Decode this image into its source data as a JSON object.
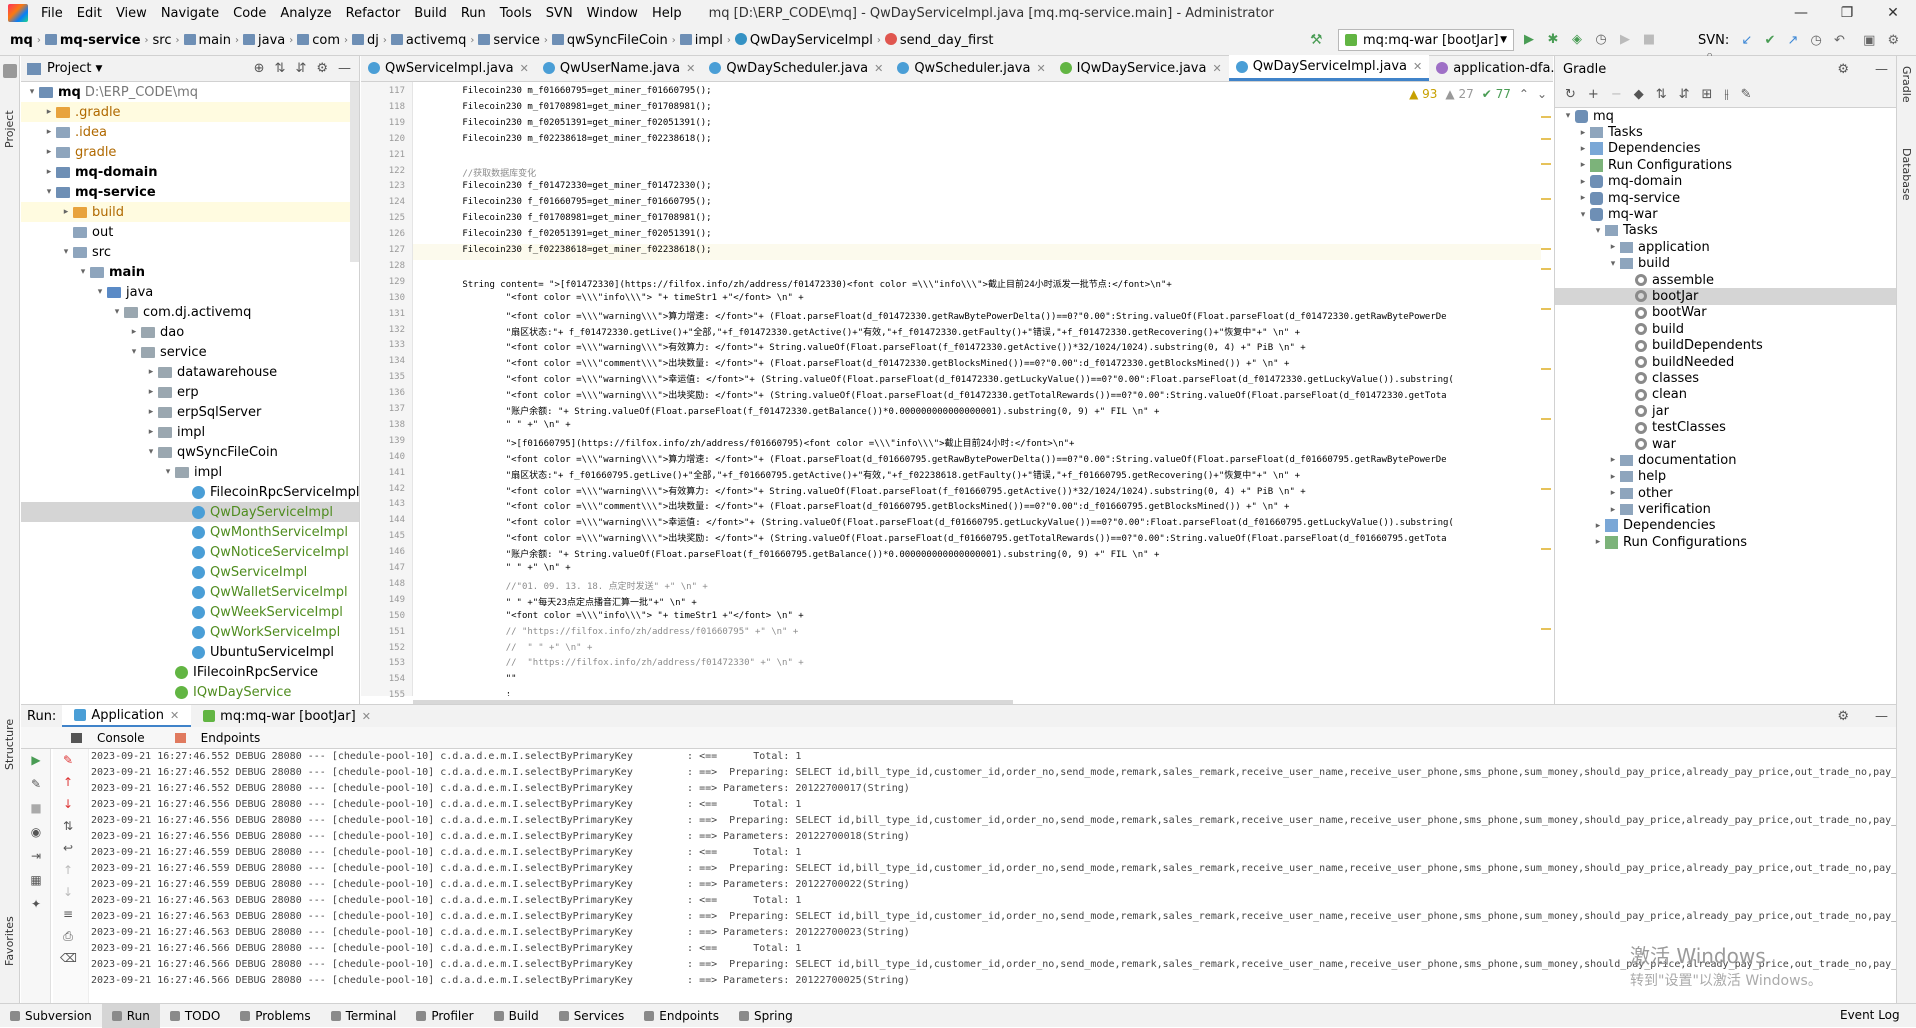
{
  "window": {
    "title": "mq [D:\\ERP_CODE\\mq] - QwDayServiceImpl.java [mq.mq-service.main] - Administrator",
    "menu": [
      "File",
      "Edit",
      "View",
      "Navigate",
      "Code",
      "Analyze",
      "Refactor",
      "Build",
      "Run",
      "Tools",
      "SVN",
      "Window",
      "Help"
    ],
    "controls": [
      "—",
      "❐",
      "✕"
    ]
  },
  "breadcrumb": [
    "mq",
    "mq-service",
    "src",
    "main",
    "java",
    "com",
    "dj",
    "activemq",
    "service",
    "qwSyncFileCoin",
    "impl",
    "QwDayServiceImpl",
    "send_day_first"
  ],
  "run_config": "mq:mq-war [bootJar]",
  "svn_label": "SVN:",
  "project_panel": {
    "title": "Project",
    "tree": [
      {
        "label": "mq",
        "extra": "D:\\ERP_CODE\\mq",
        "depth": 0,
        "arrow": "▾",
        "icon": "mod",
        "style": "b"
      },
      {
        "label": ".gradle",
        "depth": 1,
        "arrow": "▸",
        "icon": "orange",
        "style": "o",
        "hl": true
      },
      {
        "label": ".idea",
        "depth": 1,
        "arrow": "▸",
        "icon": "folder",
        "style": "o"
      },
      {
        "label": "gradle",
        "depth": 1,
        "arrow": "▸",
        "icon": "folder",
        "style": "o"
      },
      {
        "label": "mq-domain",
        "depth": 1,
        "arrow": "▸",
        "icon": "mod",
        "style": "b"
      },
      {
        "label": "mq-service",
        "depth": 1,
        "arrow": "▾",
        "icon": "mod",
        "style": "b"
      },
      {
        "label": "build",
        "depth": 2,
        "arrow": "▸",
        "icon": "orange",
        "style": "o",
        "hl": true
      },
      {
        "label": "out",
        "depth": 2,
        "arrow": "",
        "icon": "folder",
        "style": ""
      },
      {
        "label": "src",
        "depth": 2,
        "arrow": "▾",
        "icon": "folder",
        "style": ""
      },
      {
        "label": "main",
        "depth": 3,
        "arrow": "▾",
        "icon": "folder",
        "style": "b"
      },
      {
        "label": "java",
        "depth": 4,
        "arrow": "▾",
        "icon": "src",
        "style": ""
      },
      {
        "label": "com.dj.activemq",
        "depth": 5,
        "arrow": "▾",
        "icon": "pkg",
        "style": ""
      },
      {
        "label": "dao",
        "depth": 6,
        "arrow": "▸",
        "icon": "pkg",
        "style": ""
      },
      {
        "label": "service",
        "depth": 6,
        "arrow": "▾",
        "icon": "pkg",
        "style": ""
      },
      {
        "label": "datawarehouse",
        "depth": 7,
        "arrow": "▸",
        "icon": "pkg",
        "style": ""
      },
      {
        "label": "erp",
        "depth": 7,
        "arrow": "▸",
        "icon": "pkg",
        "style": ""
      },
      {
        "label": "erpSqlServer",
        "depth": 7,
        "arrow": "▸",
        "icon": "pkg",
        "style": ""
      },
      {
        "label": "impl",
        "depth": 7,
        "arrow": "▸",
        "icon": "pkg",
        "style": ""
      },
      {
        "label": "qwSyncFileCoin",
        "depth": 7,
        "arrow": "▾",
        "icon": "pkg",
        "style": ""
      },
      {
        "label": "impl",
        "depth": 8,
        "arrow": "▾",
        "icon": "pkg",
        "style": ""
      },
      {
        "label": "FilecoinRpcServiceImpl",
        "depth": 9,
        "arrow": "",
        "icon": "cls",
        "style": ""
      },
      {
        "label": "QwDayServiceImpl",
        "depth": 9,
        "arrow": "",
        "icon": "cls",
        "style": "g",
        "sel": true
      },
      {
        "label": "QwMonthServiceImpl",
        "depth": 9,
        "arrow": "",
        "icon": "cls",
        "style": "g"
      },
      {
        "label": "QwNoticeServiceImpl",
        "depth": 9,
        "arrow": "",
        "icon": "cls",
        "style": "g"
      },
      {
        "label": "QwServiceImpl",
        "depth": 9,
        "arrow": "",
        "icon": "cls",
        "style": "g"
      },
      {
        "label": "QwWalletServiceImpl",
        "depth": 9,
        "arrow": "",
        "icon": "cls",
        "style": "g"
      },
      {
        "label": "QwWeekServiceImpl",
        "depth": 9,
        "arrow": "",
        "icon": "cls",
        "style": "g"
      },
      {
        "label": "QwWorkServiceImpl",
        "depth": 9,
        "arrow": "",
        "icon": "cls",
        "style": "g"
      },
      {
        "label": "UbuntuServiceImpl",
        "depth": 9,
        "arrow": "",
        "icon": "cls",
        "style": ""
      },
      {
        "label": "IFilecoinRpcService",
        "depth": 8,
        "arrow": "",
        "icon": "int",
        "style": ""
      },
      {
        "label": "IQwDayService",
        "depth": 8,
        "arrow": "",
        "icon": "int",
        "style": "g"
      }
    ]
  },
  "editor": {
    "tabs": [
      {
        "label": "QwServiceImpl.java",
        "icon": "c"
      },
      {
        "label": "QwUserName.java",
        "icon": "c"
      },
      {
        "label": "QwDayScheduler.java",
        "icon": "c"
      },
      {
        "label": "QwScheduler.java",
        "icon": "c"
      },
      {
        "label": "IQwDayService.java",
        "icon": "i"
      },
      {
        "label": "QwDayServiceImpl.java",
        "icon": "c",
        "active": true
      },
      {
        "label": "application-dfa.propertie",
        "icon": "y"
      }
    ],
    "inspections": {
      "warn": "▲ 93",
      "weak": "▲ 27",
      "ok": "✔ 77"
    },
    "first_line": 117,
    "current_line": 127,
    "lines": [
      "        Filecoin230 m_f01660795=get_miner_f01660795();",
      "        Filecoin230 m_f01708981=get_miner_f01708981();",
      "        Filecoin230 m_f02051391=get_miner_f02051391();",
      "        Filecoin230 m_f02238618=get_miner_f02238618();",
      "",
      "        //获取数据库变化",
      "        Filecoin230 f_f01472330=get_miner_f01472330();",
      "        Filecoin230 f_f01660795=get_miner_f01660795();",
      "        Filecoin230 f_f01708981=get_miner_f01708981();",
      "        Filecoin230 f_f02051391=get_miner_f02051391();",
      "        Filecoin230 f_f02238618=get_miner_f02238618();",
      "",
      "        String content= \">[f01472330](https://filfox.info/zh/address/f01472330)<font color =\\\\\\\"info\\\\\\\">截止目前24小时派发一批节点:</font>\\n\"+",
      "                \"<font color =\\\\\\\"info\\\\\\\"> \"+ timeStr1 +\"</font> \\n\" +",
      "                \"<font color =\\\\\\\"warning\\\\\\\">算力增速: </font>\"+ (Float.parseFloat(d_f01472330.getRawBytePowerDelta())==0?\"0.00\":String.valueOf(Float.parseFloat(d_f01472330.getRawBytePowerDe",
      "                \"扇区状态:\"+ f_f01472330.getLive()+\"全部,\"+f_f01472330.getActive()+\"有效,\"+f_f01472330.getFaulty()+\"错误,\"+f_f01472330.getRecovering()+\"恢复中\"+\" \\n\" +",
      "                \"<font color =\\\\\\\"warning\\\\\\\">有效算力: </font>\"+ String.valueOf(Float.parseFloat(f_f01472330.getActive())*32/1024/1024).substring(0, 4) +\" PiB \\n\" +",
      "                \"<font color =\\\\\\\"comment\\\\\\\">出块数量: </font>\"+ (Float.parseFloat(d_f01472330.getBlocksMined())==0?\"0.00\":d_f01472330.getBlocksMined()) +\" \\n\" +",
      "                \"<font color =\\\\\\\"warning\\\\\\\">幸运值: </font>\"+ (String.valueOf(Float.parseFloat(d_f01472330.getLuckyValue())==0?\"0.00\":Float.parseFloat(d_f01472330.getLuckyValue()).substring(",
      "                \"<font color =\\\\\\\"warning\\\\\\\">出块奖励: </font>\"+ (String.valueOf(Float.parseFloat(d_f01472330.getTotalRewards())==0?\"0.00\":String.valueOf(Float.parseFloat(d_f01472330.getTota",
      "                \"账户余额: \"+ String.valueOf(Float.parseFloat(f_f01472330.getBalance())*0.000000000000000001).substring(0, 9) +\" FIL \\n\" +",
      "                \" \" +\" \\n\" +",
      "                \">[f01660795](https://filfox.info/zh/address/f01660795)<font color =\\\\\\\"info\\\\\\\">截止目前24小时:</font>\\n\"+",
      "                \"<font color =\\\\\\\"warning\\\\\\\">算力增速: </font>\"+ (Float.parseFloat(d_f01660795.getRawBytePowerDelta())==0?\"0.00\":String.valueOf(Float.parseFloat(d_f01660795.getRawBytePowerDe",
      "                \"扇区状态:\"+ f_f01660795.getLive()+\"全部,\"+f_f01660795.getActive()+\"有效,\"+f_f02238618.getFaulty()+\"错误,\"+f_f01660795.getRecovering()+\"恢复中\"+\" \\n\" +",
      "                \"<font color =\\\\\\\"warning\\\\\\\">有效算力: </font>\"+ String.valueOf(Float.parseFloat(f_f01660795.getActive())*32/1024/1024).substring(0, 4) +\" PiB \\n\" +",
      "                \"<font color =\\\\\\\"comment\\\\\\\">出块数量: </font>\"+ (Float.parseFloat(d_f01660795.getBlocksMined())==0?\"0.00\":d_f01660795.getBlocksMined()) +\" \\n\" +",
      "                \"<font color =\\\\\\\"warning\\\\\\\">幸运值: </font>\"+ (String.valueOf(Float.parseFloat(d_f01660795.getLuckyValue())==0?\"0.00\":Float.parseFloat(d_f01660795.getLuckyValue()).substring(",
      "                \"<font color =\\\\\\\"warning\\\\\\\">出块奖励: </font>\"+ (String.valueOf(Float.parseFloat(d_f01660795.getTotalRewards())==0?\"0.00\":String.valueOf(Float.parseFloat(d_f01660795.getTota",
      "                \"账户余额: \"+ String.valueOf(Float.parseFloat(f_f01660795.getBalance())*0.000000000000000001).substring(0, 9) +\" FIL \\n\" +",
      "                \" \" +\" \\n\" +",
      "                //\"01. 09. 13. 18. 点定时发送\" +\" \\n\" +",
      "                \" \" +\"每天23点定点播音汇算一批\"+\" \\n\" +",
      "                \"<font color =\\\\\\\"info\\\\\\\"> \"+ timeStr1 +\"</font> \\n\" +",
      "                // \"https://filfox.info/zh/address/f01660795\" +\" \\n\" +",
      "                //  \" \" +\" \\n\" +",
      "                //  \"https://filfox.info/zh/address/f01472330\" +\" \\n\" +",
      "                \"\"",
      "                ;"
    ]
  },
  "gradle_panel": {
    "title": "Gradle",
    "tree": [
      {
        "label": "mq",
        "depth": 0,
        "arrow": "▾",
        "icon": "elep"
      },
      {
        "label": "Tasks",
        "depth": 1,
        "arrow": "▸",
        "icon": "folder"
      },
      {
        "label": "Dependencies",
        "depth": 1,
        "arrow": "▸",
        "icon": "dep"
      },
      {
        "label": "Run Configurations",
        "depth": 1,
        "arrow": "▸",
        "icon": "cfg"
      },
      {
        "label": "mq-domain",
        "depth": 1,
        "arrow": "▸",
        "icon": "elep"
      },
      {
        "label": "mq-service",
        "depth": 1,
        "arrow": "▸",
        "icon": "elep"
      },
      {
        "label": "mq-war",
        "depth": 1,
        "arrow": "▾",
        "icon": "elep"
      },
      {
        "label": "Tasks",
        "depth": 2,
        "arrow": "▾",
        "icon": "folder"
      },
      {
        "label": "application",
        "depth": 3,
        "arrow": "▸",
        "icon": "folder"
      },
      {
        "label": "build",
        "depth": 3,
        "arrow": "▾",
        "icon": "folder"
      },
      {
        "label": "assemble",
        "depth": 4,
        "arrow": "",
        "icon": "gear"
      },
      {
        "label": "bootJar",
        "depth": 4,
        "arrow": "",
        "icon": "gear",
        "sel": true
      },
      {
        "label": "bootWar",
        "depth": 4,
        "arrow": "",
        "icon": "gear"
      },
      {
        "label": "build",
        "depth": 4,
        "arrow": "",
        "icon": "gear"
      },
      {
        "label": "buildDependents",
        "depth": 4,
        "arrow": "",
        "icon": "gear"
      },
      {
        "label": "buildNeeded",
        "depth": 4,
        "arrow": "",
        "icon": "gear"
      },
      {
        "label": "classes",
        "depth": 4,
        "arrow": "",
        "icon": "gear"
      },
      {
        "label": "clean",
        "depth": 4,
        "arrow": "",
        "icon": "gear"
      },
      {
        "label": "jar",
        "depth": 4,
        "arrow": "",
        "icon": "gear"
      },
      {
        "label": "testClasses",
        "depth": 4,
        "arrow": "",
        "icon": "gear"
      },
      {
        "label": "war",
        "depth": 4,
        "arrow": "",
        "icon": "gear"
      },
      {
        "label": "documentation",
        "depth": 3,
        "arrow": "▸",
        "icon": "folder"
      },
      {
        "label": "help",
        "depth": 3,
        "arrow": "▸",
        "icon": "folder"
      },
      {
        "label": "other",
        "depth": 3,
        "arrow": "▸",
        "icon": "folder"
      },
      {
        "label": "verification",
        "depth": 3,
        "arrow": "▸",
        "icon": "folder"
      },
      {
        "label": "Dependencies",
        "depth": 2,
        "arrow": "▸",
        "icon": "dep"
      },
      {
        "label": "Run Configurations",
        "depth": 2,
        "arrow": "▸",
        "icon": "cfg"
      }
    ]
  },
  "run_panel": {
    "label": "Run:",
    "tabs": [
      "Application",
      "mq:mq-war [bootJar]"
    ],
    "subtabs": [
      "Console",
      "Endpoints"
    ],
    "log": [
      "2023-09-21 16:27:46.552 DEBUG 28080 --- [chedule-pool-10] c.d.a.d.e.m.I.selectByPrimaryKey         : <==      Total: 1",
      "2023-09-21 16:27:46.552 DEBUG 28080 --- [chedule-pool-10] c.d.a.d.e.m.I.selectByPrimaryKey         : ==>  Preparing: SELECT id,bill_type_id,customer_id,order_no,send_mode,remark,sales_remark,receive_user_name,receive_user_phone,sms_phone,sum_money,should_pay_price,already_pay_price,out_trade_no,pay_ti",
      "2023-09-21 16:27:46.552 DEBUG 28080 --- [chedule-pool-10] c.d.a.d.e.m.I.selectByPrimaryKey         : ==> Parameters: 20122700017(String)",
      "2023-09-21 16:27:46.556 DEBUG 28080 --- [chedule-pool-10] c.d.a.d.e.m.I.selectByPrimaryKey         : <==      Total: 1",
      "2023-09-21 16:27:46.556 DEBUG 28080 --- [chedule-pool-10] c.d.a.d.e.m.I.selectByPrimaryKey         : ==>  Preparing: SELECT id,bill_type_id,customer_id,order_no,send_mode,remark,sales_remark,receive_user_name,receive_user_phone,sms_phone,sum_money,should_pay_price,already_pay_price,out_trade_no,pay_ti",
      "2023-09-21 16:27:46.556 DEBUG 28080 --- [chedule-pool-10] c.d.a.d.e.m.I.selectByPrimaryKey         : ==> Parameters: 20122700018(String)",
      "2023-09-21 16:27:46.559 DEBUG 28080 --- [chedule-pool-10] c.d.a.d.e.m.I.selectByPrimaryKey         : <==      Total: 1",
      "2023-09-21 16:27:46.559 DEBUG 28080 --- [chedule-pool-10] c.d.a.d.e.m.I.selectByPrimaryKey         : ==>  Preparing: SELECT id,bill_type_id,customer_id,order_no,send_mode,remark,sales_remark,receive_user_name,receive_user_phone,sms_phone,sum_money,should_pay_price,already_pay_price,out_trade_no,pay_ti",
      "2023-09-21 16:27:46.559 DEBUG 28080 --- [chedule-pool-10] c.d.a.d.e.m.I.selectByPrimaryKey         : ==> Parameters: 20122700022(String)",
      "2023-09-21 16:27:46.563 DEBUG 28080 --- [chedule-pool-10] c.d.a.d.e.m.I.selectByPrimaryKey         : <==      Total: 1",
      "2023-09-21 16:27:46.563 DEBUG 28080 --- [chedule-pool-10] c.d.a.d.e.m.I.selectByPrimaryKey         : ==>  Preparing: SELECT id,bill_type_id,customer_id,order_no,send_mode,remark,sales_remark,receive_user_name,receive_user_phone,sms_phone,sum_money,should_pay_price,already_pay_price,out_trade_no,pay_ti",
      "2023-09-21 16:27:46.563 DEBUG 28080 --- [chedule-pool-10] c.d.a.d.e.m.I.selectByPrimaryKey         : ==> Parameters: 20122700023(String)",
      "2023-09-21 16:27:46.566 DEBUG 28080 --- [chedule-pool-10] c.d.a.d.e.m.I.selectByPrimaryKey         : <==      Total: 1",
      "2023-09-21 16:27:46.566 DEBUG 28080 --- [chedule-pool-10] c.d.a.d.e.m.I.selectByPrimaryKey         : ==>  Preparing: SELECT id,bill_type_id,customer_id,order_no,send_mode,remark,sales_remark,receive_user_name,receive_user_phone,sms_phone,sum_money,should_pay_price,already_pay_price,out_trade_no,pay_ti",
      "2023-09-21 16:27:46.566 DEBUG 28080 --- [chedule-pool-10] c.d.a.d.e.m.I.selectByPrimaryKey         : ==> Parameters: 20122700025(String)"
    ]
  },
  "bottom_tabs": [
    "Subversion",
    "Run",
    "TODO",
    "Problems",
    "Terminal",
    "Profiler",
    "Build",
    "Services",
    "Endpoints",
    "Spring"
  ],
  "event_log": "Event Log",
  "side_labels": {
    "left_top": "Project",
    "left_mid": "Structure",
    "left_bot": "Favorites",
    "right_top": "Gradle",
    "right_mid": "Database"
  },
  "watermark": {
    "line1": "激活 Windows",
    "line2": "转到\"设置\"以激活 Windows。"
  }
}
